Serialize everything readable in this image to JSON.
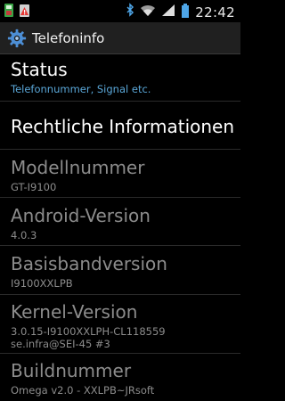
{
  "statusbar": {
    "time": "22:42",
    "left_icons": [
      "notification-app-icon",
      "notification-warning-icon"
    ],
    "right_icons": [
      "bluetooth-icon",
      "wifi-icon",
      "signal-icon",
      "battery-icon"
    ]
  },
  "actionbar": {
    "icon": "gear-icon",
    "title": "Telefoninfo"
  },
  "items": [
    {
      "title": "Status",
      "summary": "Telefonnummer, Signal etc.",
      "enabled": true
    },
    {
      "title": "Rechtliche Informationen",
      "summary": "",
      "enabled": true
    },
    {
      "title": "Modellnummer",
      "summary": "GT-I9100",
      "enabled": false
    },
    {
      "title": "Android-Version",
      "summary": "4.0.3",
      "enabled": false
    },
    {
      "title": "Basisbandversion",
      "summary": "I9100XXLPB",
      "enabled": false
    },
    {
      "title": "Kernel-Version",
      "summary_lines": [
        "3.0.15-I9100XXLPH-CL118559",
        "se.infra@SEI-45 #3"
      ],
      "enabled": false
    },
    {
      "title": "Buildnummer",
      "summary": "Omega v2.0 - XXLPB~JRsoft",
      "enabled": false
    }
  ],
  "colors": {
    "background": "#000000",
    "actionbar": "#202020",
    "summary_accent": "#5aa7d8",
    "disabled_text": "#8c8c8c"
  }
}
